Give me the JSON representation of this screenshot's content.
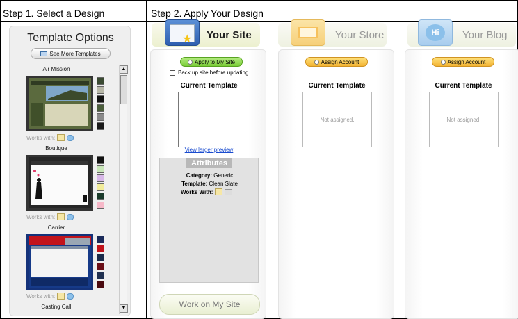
{
  "steps": {
    "step1": "Step 1. Select a Design",
    "step2": "Step 2. Apply Your Design"
  },
  "left_panel": {
    "heading": "Template Options",
    "see_more": "See More Templates",
    "templates": [
      {
        "name": "Air Mission",
        "works_with": "Works with:",
        "swatches": [
          "#3a4a32",
          "#b8b8a8",
          "#111111",
          "#4a5d3b",
          "#8a8a8a",
          "#1a1a1a"
        ]
      },
      {
        "name": "Boutique",
        "works_with": "Works with:",
        "swatches": [
          "#111111",
          "#c8e6b8",
          "#d8b8e8",
          "#f2ec9a",
          "#1a3a2a",
          "#f6b8c8"
        ]
      },
      {
        "name": "Carrier",
        "works_with": "Works with:",
        "swatches": [
          "#1a2a5a",
          "#c0121a",
          "#1a2a4a",
          "#6a0e18",
          "#203050",
          "#4a0a10"
        ]
      },
      {
        "name": "Casting Call"
      }
    ],
    "scroll_up": "▲",
    "scroll_down": "▼"
  },
  "columns": {
    "site": {
      "title": "Your Site",
      "button": "Apply to My Site",
      "backup_label": "Back up site before updating",
      "current_template": "Current Template",
      "preview_link": "View larger preview",
      "attributes_title": "Attributes",
      "category_label": "Category:",
      "category_value": "Generic",
      "template_label": "Template:",
      "template_value": "Clean Slate",
      "works_with_label": "Works With:",
      "work_button": "Work on My Site"
    },
    "store": {
      "title": "Your Store",
      "button": "Assign Account",
      "current_template": "Current Template",
      "status": "Not assigned."
    },
    "blog": {
      "title": "Your Blog",
      "button": "Assign Account",
      "current_template": "Current Template",
      "status": "Not assigned.",
      "icon_text": "Hi"
    }
  }
}
